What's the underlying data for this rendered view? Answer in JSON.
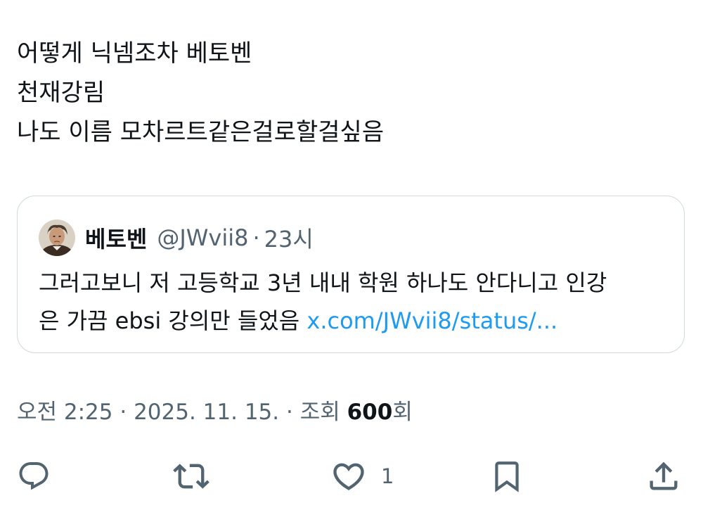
{
  "tweet": {
    "lines": [
      "어떻게 닉넴조차 베토벤",
      "천재강림",
      "나도 이름 모차르트같은걸로할걸싶음"
    ]
  },
  "quote": {
    "author_name": "베토벤",
    "handle": "@JWvii8",
    "separator": "·",
    "time": "23시",
    "body_line1": "그러고보니 저 고등학교 3년 내내 학원 하나도 안다니고 인강",
    "body_line2_text": "은 가끔 ebsi 강의만 들었음 ",
    "link": "x.com/JWvii8/status/..."
  },
  "meta": {
    "time": "오전 2:25",
    "sep1": " · ",
    "date": "2025. 11. 15.",
    "sep2": " · ",
    "views_label": "조회 ",
    "views_count": "600",
    "views_suffix": "회"
  },
  "actions": {
    "like_count": "1",
    "icons": [
      "reply-icon",
      "retweet-icon",
      "like-icon",
      "bookmark-icon",
      "share-icon"
    ]
  },
  "colors": {
    "text": "#0f1419",
    "secondary": "#536471",
    "link": "#1d9bf0",
    "border": "#cfd9de"
  }
}
